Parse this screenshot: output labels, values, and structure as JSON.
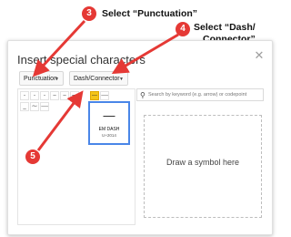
{
  "annotations": {
    "step3": {
      "number": "3",
      "text": "Select “Punctuation”"
    },
    "step4": {
      "number": "4",
      "line1": "Select “Dash/",
      "line2": "Connector”"
    },
    "step5": {
      "number": "5"
    }
  },
  "dialog": {
    "title": "Insert special characters",
    "close_icon": "close-icon",
    "category_dropdown": "Punctuation",
    "subcategory_dropdown": "Dash/Connector",
    "search_placeholder": "Search by keyword (e.g. arrow) or codepoint",
    "draw_text": "Draw a symbol here",
    "grid_row1": [
      "-",
      "‐",
      "‑",
      "‒",
      "–",
      "—",
      "―",
      "⸺"
    ],
    "grid_row2": [
      "_",
      "⁓",
      "⸻"
    ],
    "preview": {
      "symbol": "—",
      "name": "EM DASH",
      "codepoint": "U+2014"
    }
  },
  "colors": {
    "annotation_red": "#e53935",
    "selected_cell": "#f5c518",
    "preview_border": "#4a86e8"
  }
}
